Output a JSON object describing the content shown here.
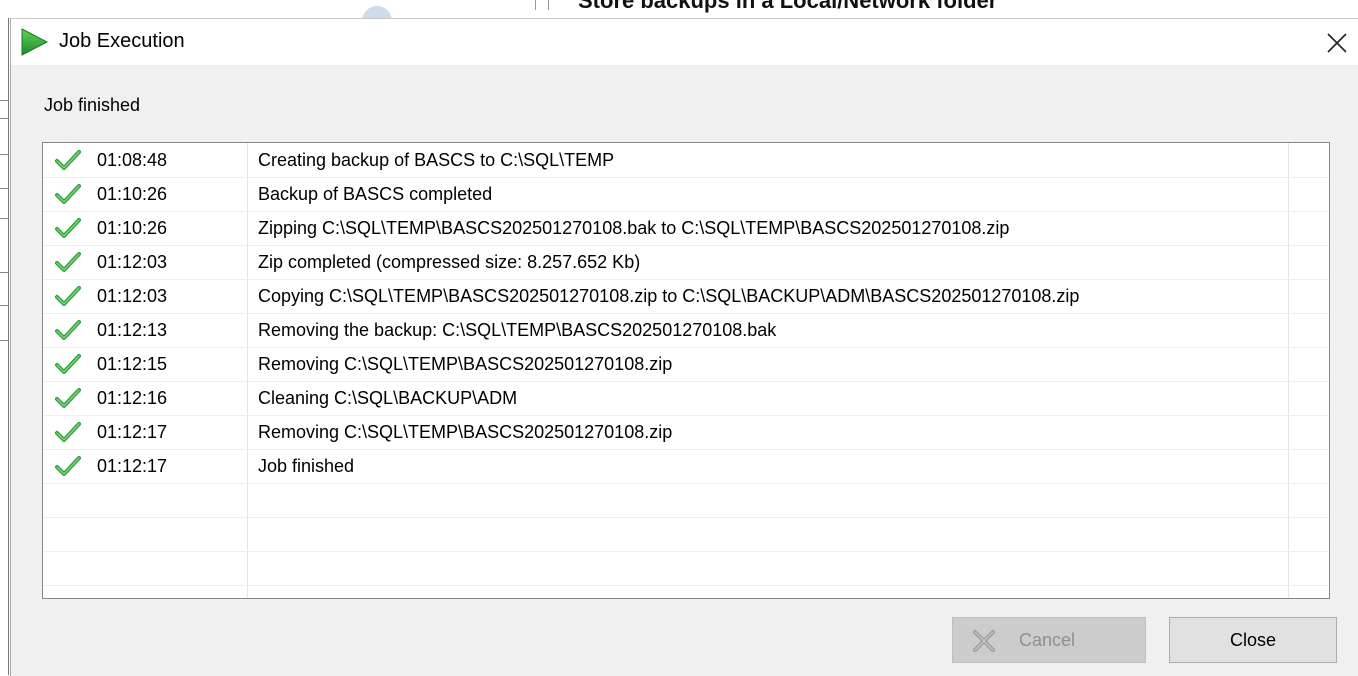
{
  "background": {
    "partial_text": "Store backups in a Local/Network folder"
  },
  "dialog": {
    "title": "Job Execution",
    "title_icon": "green-play-arrow-icon",
    "close_icon": "close-icon",
    "status": "Job finished",
    "log": [
      {
        "icon": "green-check-icon",
        "time": "01:08:48",
        "message": "Creating backup of BASCS to C:\\SQL\\TEMP"
      },
      {
        "icon": "green-check-icon",
        "time": "01:10:26",
        "message": "Backup of BASCS completed"
      },
      {
        "icon": "green-check-icon",
        "time": "01:10:26",
        "message": "Zipping C:\\SQL\\TEMP\\BASCS202501270108.bak to C:\\SQL\\TEMP\\BASCS202501270108.zip"
      },
      {
        "icon": "green-check-icon",
        "time": "01:12:03",
        "message": "Zip completed (compressed size: 8.257.652 Kb)"
      },
      {
        "icon": "green-check-icon",
        "time": "01:12:03",
        "message": "Copying C:\\SQL\\TEMP\\BASCS202501270108.zip to C:\\SQL\\BACKUP\\ADM\\BASCS202501270108.zip"
      },
      {
        "icon": "green-check-icon",
        "time": "01:12:13",
        "message": "Removing the backup: C:\\SQL\\TEMP\\BASCS202501270108.bak"
      },
      {
        "icon": "green-check-icon",
        "time": "01:12:15",
        "message": "Removing C:\\SQL\\TEMP\\BASCS202501270108.zip"
      },
      {
        "icon": "green-check-icon",
        "time": "01:12:16",
        "message": "Cleaning C:\\SQL\\BACKUP\\ADM"
      },
      {
        "icon": "green-check-icon",
        "time": "01:12:17",
        "message": "Removing C:\\SQL\\TEMP\\BASCS202501270108.zip"
      },
      {
        "icon": "green-check-icon",
        "time": "01:12:17",
        "message": "Job finished"
      }
    ],
    "buttons": {
      "cancel_label": "Cancel",
      "cancel_enabled": false,
      "close_label": "Close"
    }
  },
  "colors": {
    "accent_green": "#3cb043",
    "dialog_bg": "#f0f0f0",
    "disabled_text": "#8f8f8f"
  }
}
